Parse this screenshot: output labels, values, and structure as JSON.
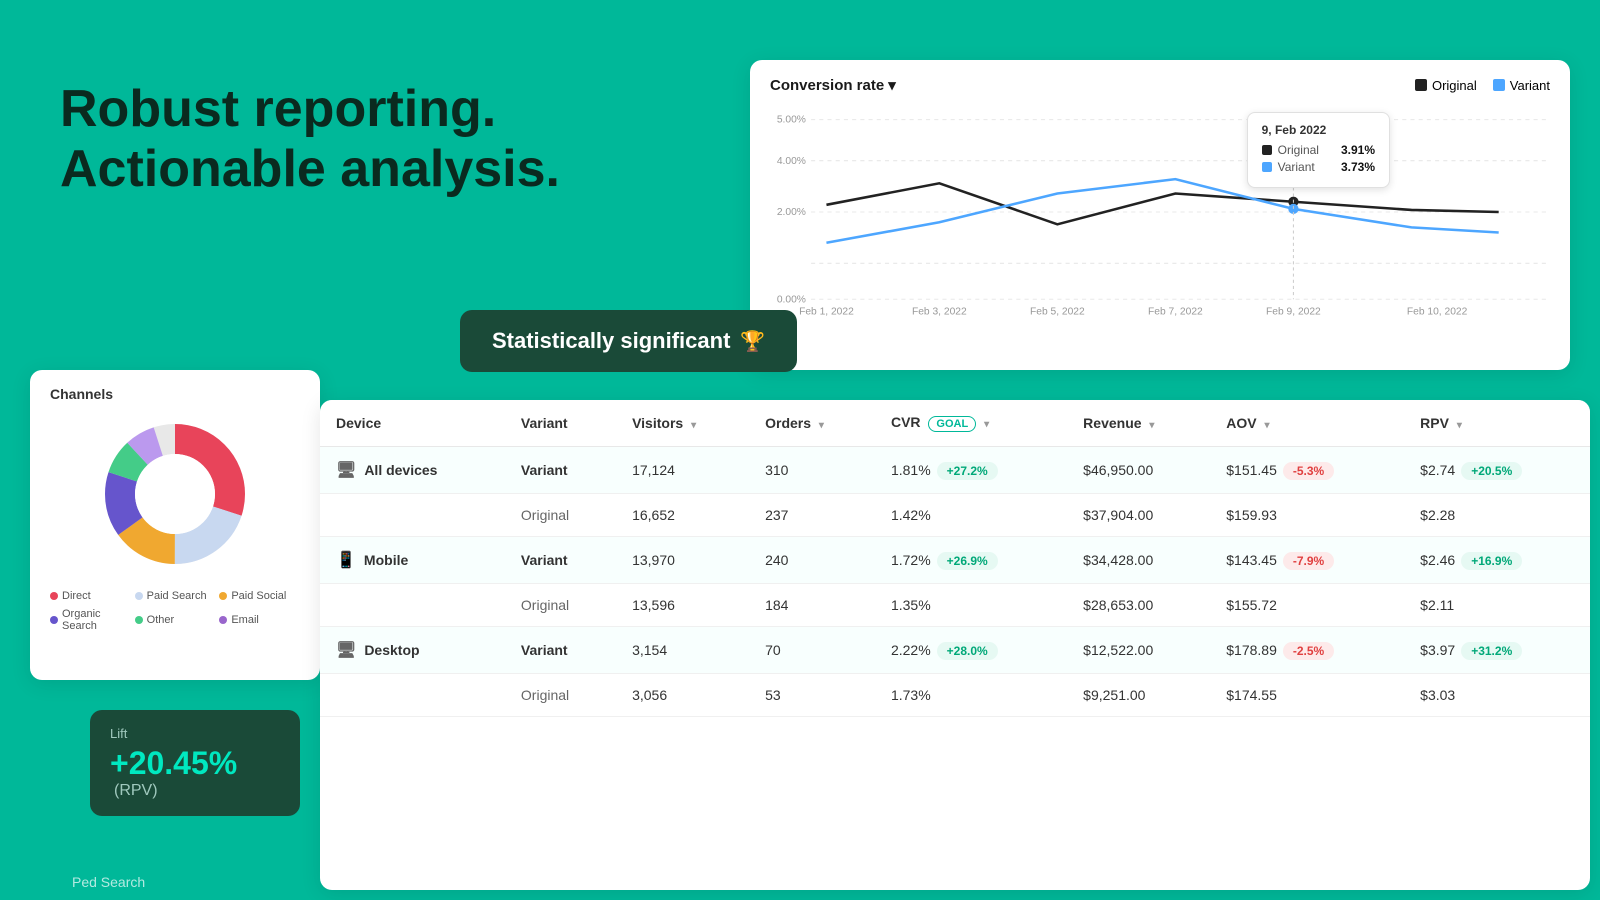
{
  "hero": {
    "line1": "Robust reporting.",
    "line2": "Actionable analysis."
  },
  "stat_sig": {
    "label": "Statistically significant",
    "icon": "🏆"
  },
  "chart": {
    "title": "Conversion rate",
    "dropdown_icon": "▾",
    "legend": [
      {
        "label": "Original",
        "color": "#222222"
      },
      {
        "label": "Variant",
        "color": "#4da6ff"
      }
    ],
    "tooltip": {
      "date": "9, Feb 2022",
      "rows": [
        {
          "label": "Original",
          "value": "3.91%",
          "color": "#222222"
        },
        {
          "label": "Variant",
          "value": "3.73%",
          "color": "#4da6ff"
        }
      ]
    },
    "x_labels": [
      "Feb 1, 2022",
      "Feb 3, 2022",
      "Feb 5, 2022",
      "Feb 7, 2022",
      "Feb 9, 2022",
      "Feb 10, 2022"
    ],
    "y_labels": [
      "0.00%",
      "2.00%",
      "4.00%",
      "5.00%"
    ]
  },
  "channels": {
    "title": "Channels",
    "legend": [
      {
        "label": "Direct",
        "color": "#e8445a"
      },
      {
        "label": "Paid Search",
        "color": "#c8d8f0"
      },
      {
        "label": "Paid Social",
        "color": "#f0a830"
      },
      {
        "label": "Organic Search",
        "color": "#6655cc"
      },
      {
        "label": "Other",
        "color": "#44cc88"
      },
      {
        "label": "Email",
        "color": "#9966cc"
      }
    ]
  },
  "lift": {
    "label": "Lift",
    "value": "+20.45%",
    "suffix": "(RPV)"
  },
  "table": {
    "headers": [
      "Device",
      "Variant",
      "Visitors",
      "Orders",
      "CVR",
      "Revenue",
      "AOV",
      "RPV"
    ],
    "rows": [
      {
        "device": "All devices",
        "device_icon": "🖥",
        "variant": "Variant",
        "is_variant": true,
        "visitors": "17,124",
        "orders": "310",
        "cvr": "1.81%",
        "cvr_badge": "+27.2%",
        "cvr_badge_type": "green",
        "revenue": "$46,950.00",
        "aov": "$151.45",
        "aov_badge": "-5.3%",
        "aov_badge_type": "red",
        "rpv": "$2.74",
        "rpv_badge": "+20.5%",
        "rpv_badge_type": "green"
      },
      {
        "device": "",
        "device_icon": "",
        "variant": "Original",
        "is_variant": false,
        "visitors": "16,652",
        "orders": "237",
        "cvr": "1.42%",
        "cvr_badge": "",
        "revenue": "$37,904.00",
        "aov": "$159.93",
        "aov_badge": "",
        "rpv": "$2.28",
        "rpv_badge": ""
      },
      {
        "device": "Mobile",
        "device_icon": "📱",
        "variant": "Variant",
        "is_variant": true,
        "visitors": "13,970",
        "orders": "240",
        "cvr": "1.72%",
        "cvr_badge": "+26.9%",
        "cvr_badge_type": "green",
        "revenue": "$34,428.00",
        "aov": "$143.45",
        "aov_badge": "-7.9%",
        "aov_badge_type": "red",
        "rpv": "$2.46",
        "rpv_badge": "+16.9%",
        "rpv_badge_type": "green"
      },
      {
        "device": "",
        "device_icon": "",
        "variant": "Original",
        "is_variant": false,
        "visitors": "13,596",
        "orders": "184",
        "cvr": "1.35%",
        "cvr_badge": "",
        "revenue": "$28,653.00",
        "aov": "$155.72",
        "aov_badge": "",
        "rpv": "$2.11",
        "rpv_badge": ""
      },
      {
        "device": "Desktop",
        "device_icon": "🖥",
        "variant": "Variant",
        "is_variant": true,
        "visitors": "3,154",
        "orders": "70",
        "cvr": "2.22%",
        "cvr_badge": "+28.0%",
        "cvr_badge_type": "green",
        "revenue": "$12,522.00",
        "aov": "$178.89",
        "aov_badge": "-2.5%",
        "aov_badge_type": "red",
        "rpv": "$3.97",
        "rpv_badge": "+31.2%",
        "rpv_badge_type": "green"
      },
      {
        "device": "",
        "device_icon": "",
        "variant": "Original",
        "is_variant": false,
        "visitors": "3,056",
        "orders": "53",
        "cvr": "1.73%",
        "cvr_badge": "",
        "revenue": "$9,251.00",
        "aov": "$174.55",
        "aov_badge": "",
        "rpv": "$3.03",
        "rpv_badge": ""
      }
    ]
  },
  "ped_search": {
    "label": "Ped Search"
  }
}
